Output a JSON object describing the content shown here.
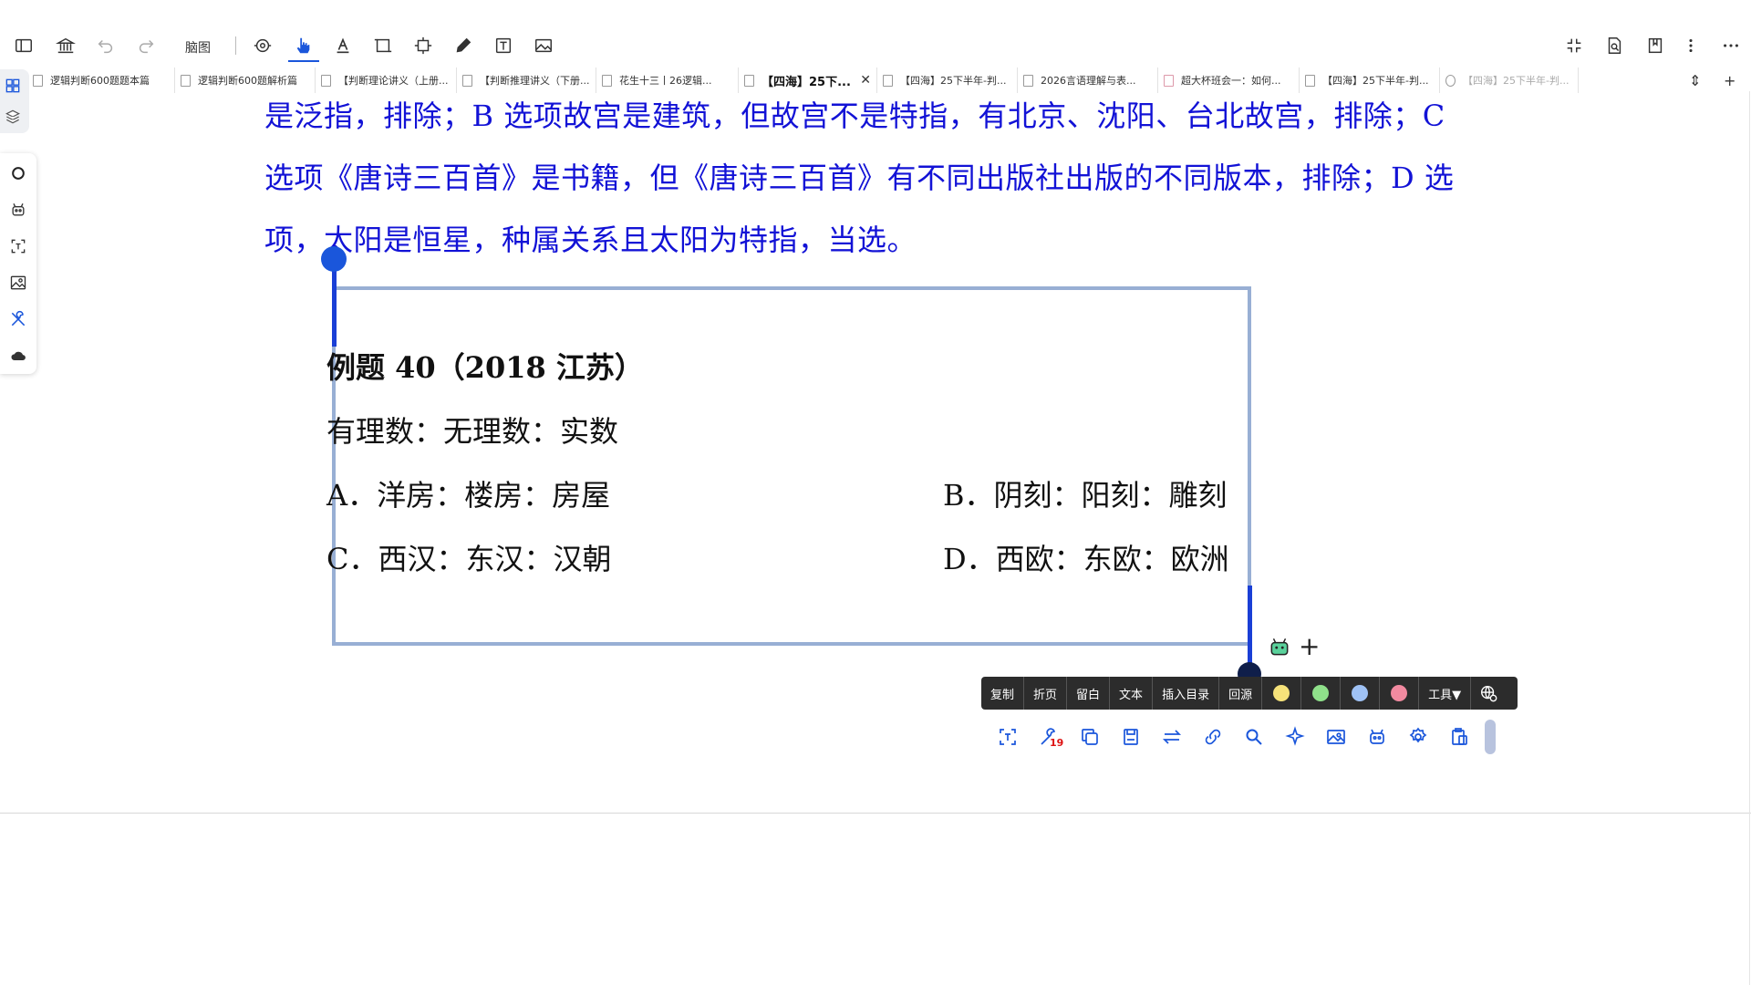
{
  "toolbar": {
    "mindmap_label": "脑图",
    "icons": [
      "sidebar-toggle-icon",
      "library-icon",
      "undo-icon",
      "redo-icon",
      "focus-icon",
      "hand-pointer-icon",
      "text-color-icon",
      "crop-icon",
      "resize-icon",
      "pen-icon",
      "textbox-icon",
      "image-icon",
      "fullscreen-exit-icon",
      "document-search-icon",
      "bookmark-icon",
      "more-vertical-icon",
      "more-horizontal-icon"
    ]
  },
  "tabs": [
    {
      "label": "逻辑判断600题题本篇",
      "state": "normal"
    },
    {
      "label": "逻辑判断600题解析篇",
      "state": "normal"
    },
    {
      "label": "【判断理论讲义（上册...",
      "state": "normal"
    },
    {
      "label": "【判断推理讲义（下册...",
      "state": "normal"
    },
    {
      "label": "花生十三丨26逻辑...",
      "state": "normal"
    },
    {
      "label": "【四海】25下...",
      "state": "active"
    },
    {
      "label": "【四海】25下半年-判...",
      "state": "normal"
    },
    {
      "label": "2026言语理解与表...",
      "state": "normal"
    },
    {
      "label": "超大杯班会一：如何...",
      "state": "normal"
    },
    {
      "label": "【四海】25下半年-判...",
      "state": "normal"
    },
    {
      "label": "【四海】25下半年-判...",
      "state": "inactive"
    }
  ],
  "document": {
    "answer_lines": [
      "是泛指，排除；B 选项故宫是建筑，但故宫不是特指，有北京、沈阳、台北故宫，排除；C",
      "选项《唐诗三百首》是书籍，但《唐诗三百首》有不同出版社出版的不同版本，排除；D 选",
      "项，太阳是恒星，种属关系且太阳为特指，当选。"
    ],
    "question_title": "例题 40（2018 江苏）",
    "question_stem": "有理数：无理数：实数",
    "options": {
      "a": "A．洋房：楼房：房屋",
      "b": "B．阴刻：阳刻：雕刻",
      "c": "C．西汉：东汉：汉朝",
      "d": "D．西欧：东欧：欧洲"
    }
  },
  "context_menu": {
    "buttons": [
      "复制",
      "折页",
      "留白",
      "文本",
      "插入目录",
      "回源"
    ],
    "colors": [
      "#f6e27a",
      "#8fe08a",
      "#9fc2f5",
      "#f28aa0"
    ],
    "tools_label": "工具▼"
  },
  "icon_row": {
    "badge_count": "19",
    "icons": [
      "ocr-scan-icon",
      "wrench-icon",
      "copy-icon",
      "save-icon",
      "swap-icon",
      "link-icon",
      "search-icon",
      "sparkle-icon",
      "image-icon",
      "robot-icon",
      "settings-icon",
      "paste-icon"
    ]
  }
}
